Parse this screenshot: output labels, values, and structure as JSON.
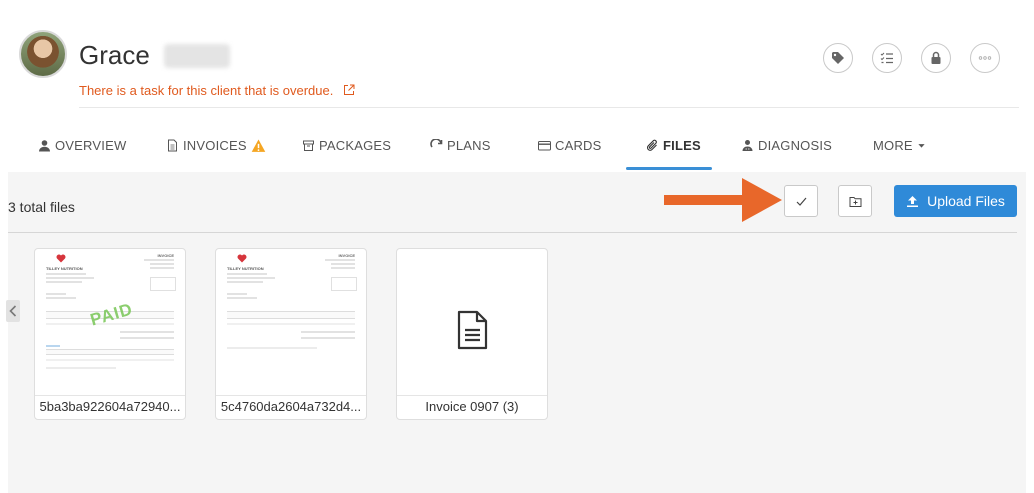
{
  "client": {
    "first_name": "Grace",
    "overdue_notice": "There is a task for this client that is overdue."
  },
  "header_actions": [
    {
      "name": "tag-icon"
    },
    {
      "name": "checklist-icon"
    },
    {
      "name": "lock-icon"
    },
    {
      "name": "more-dots-icon"
    }
  ],
  "tabs": [
    {
      "label": "OVERVIEW",
      "icon": "user-icon"
    },
    {
      "label": "INVOICES",
      "icon": "document-icon",
      "badge": "warning-icon"
    },
    {
      "label": "PACKAGES",
      "icon": "box-icon"
    },
    {
      "label": "PLANS",
      "icon": "refresh-icon"
    },
    {
      "label": "CARDS",
      "icon": "credit-card-icon"
    },
    {
      "label": "FILES",
      "icon": "paperclip-icon",
      "active": true
    },
    {
      "label": "DIAGNOSIS",
      "icon": "users-icon"
    },
    {
      "label": "MORE",
      "icon": "caret-down-icon"
    }
  ],
  "files_panel": {
    "total_label": "3 total files",
    "upload_label": "Upload Files"
  },
  "files": [
    {
      "name": "5ba3ba922604a72940...",
      "thumbnail": "invoice-paid"
    },
    {
      "name": "5c4760da2604a732d4...",
      "thumbnail": "invoice"
    },
    {
      "name": "Invoice 0907 (3)",
      "thumbnail": "file-icon"
    }
  ],
  "invoice_thumb": {
    "heading": "INVOICE",
    "brand": "TILLEY NUTRITION",
    "stamp": "PAID"
  },
  "colors": {
    "accent": "#2f8ad8",
    "warning": "#f5a623",
    "overdue": "#e05a1e",
    "arrow": "#e8672a",
    "paid": "#7fc95f"
  }
}
